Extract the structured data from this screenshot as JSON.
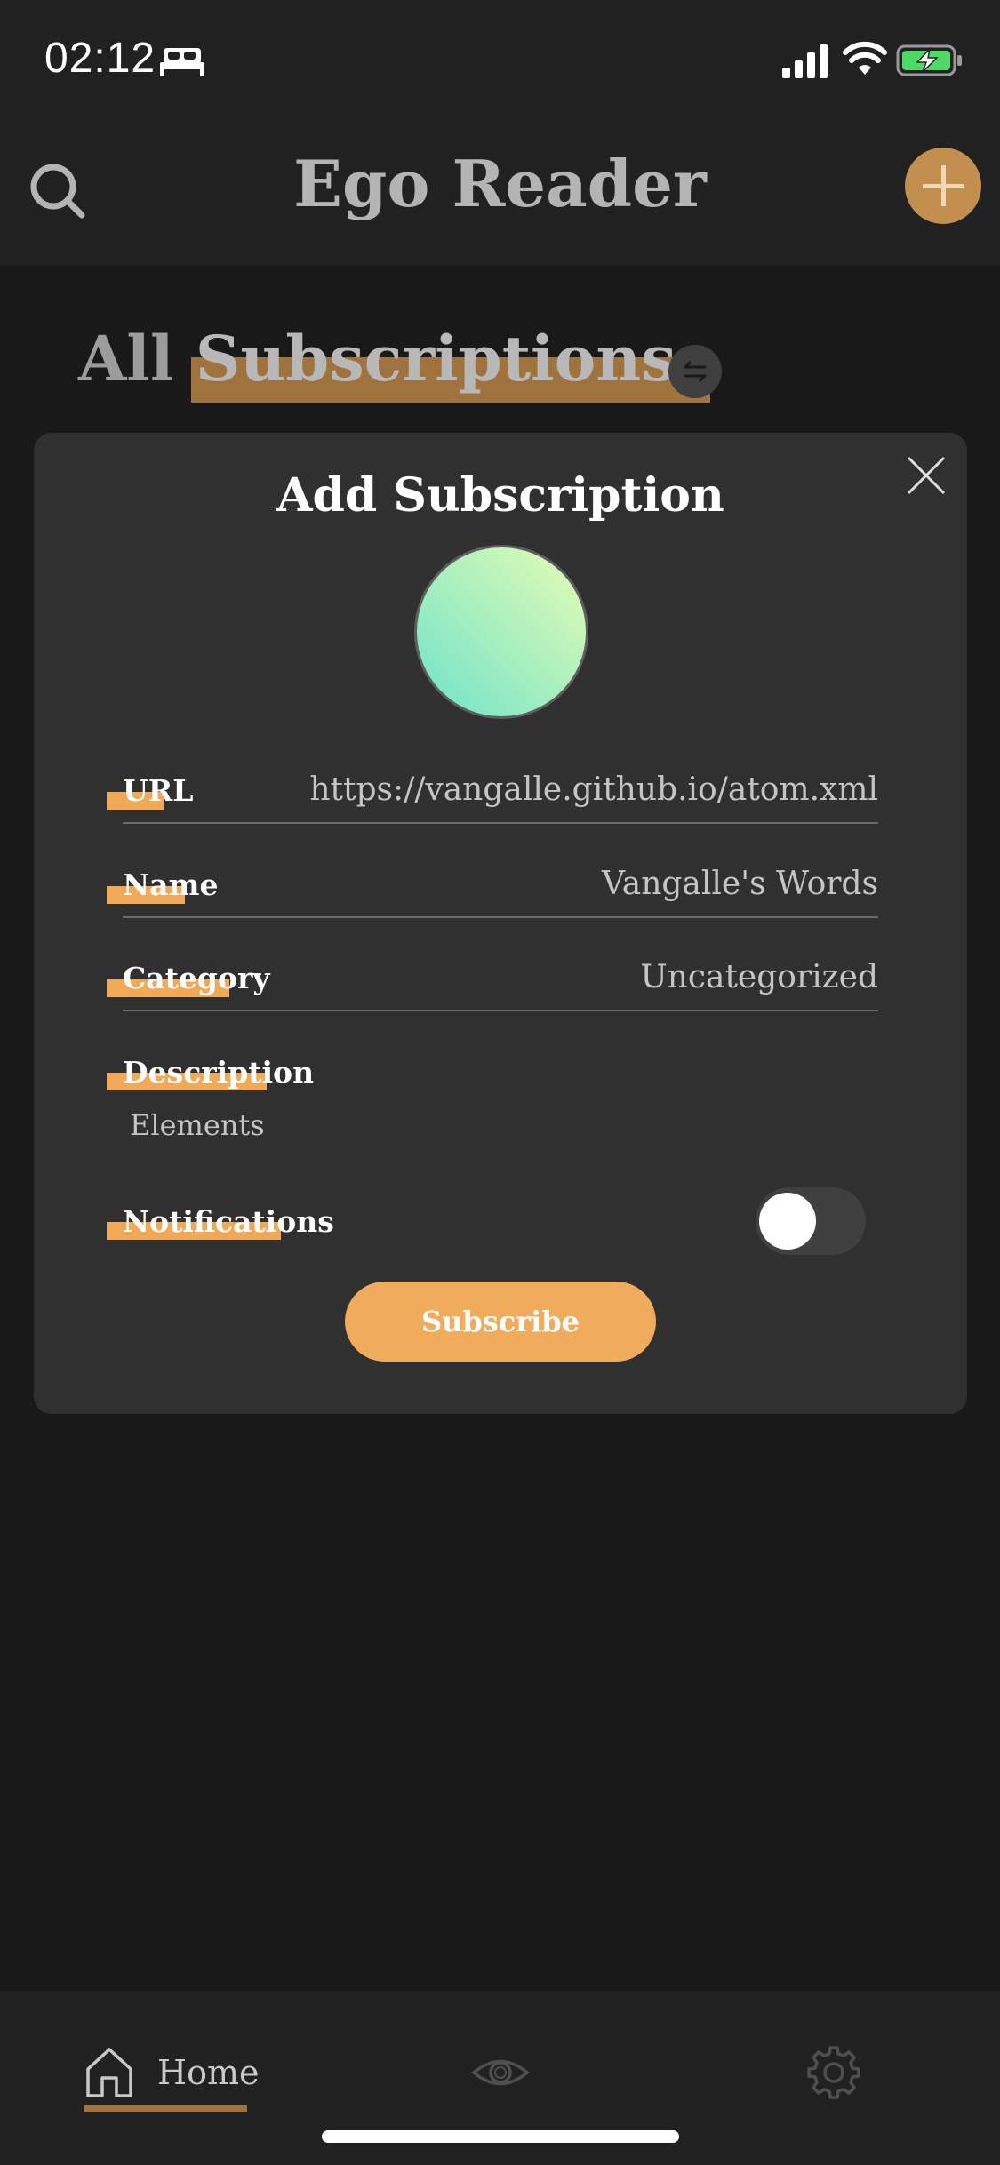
{
  "status_bar": {
    "time": "02:12",
    "icons": [
      "bed-icon",
      "signal-icon",
      "wifi-icon",
      "battery-charging-icon"
    ]
  },
  "header": {
    "title": "Ego Reader",
    "left_icon": "search-icon",
    "right_icon": "plus-icon"
  },
  "section": {
    "title_part1": "All ",
    "title_part2": "Subscriptions",
    "sort_icon": "swap-icon"
  },
  "modal": {
    "title": "Add Subscription",
    "close_icon": "close-icon",
    "avatar_colors": [
      "#e6fdb5",
      "#6fe3c9"
    ],
    "fields": [
      {
        "label": "URL",
        "value": "https://vangalle.github.io/atom.xml"
      },
      {
        "label": "Name",
        "value": "Vangalle's Words"
      },
      {
        "label": "Category",
        "value": "Uncategorized"
      }
    ],
    "description": {
      "label": "Description",
      "value": "Elements"
    },
    "notifications": {
      "label": "Notifications",
      "enabled": false
    },
    "subscribe_label": "Subscribe"
  },
  "tab_bar": {
    "home_label": "Home",
    "active_tab": "home",
    "icons": [
      "home-icon",
      "eye-icon",
      "gear-icon"
    ]
  },
  "colors": {
    "accent": "#f0ab5c",
    "accent_dark": "#a0733e",
    "background": "#191919",
    "surface": "#303030"
  }
}
